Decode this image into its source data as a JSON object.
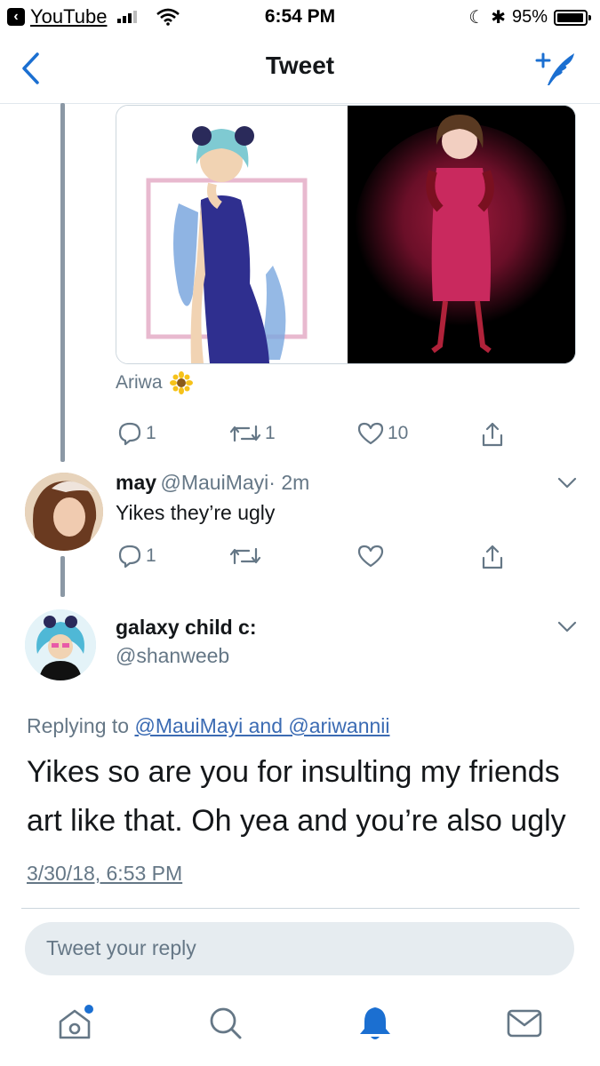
{
  "status_bar": {
    "back_app": "YouTube",
    "time": "6:54 PM",
    "battery": "95%"
  },
  "nav": {
    "title": "Tweet",
    "back_icon": "chevron-left-icon",
    "compose_icon": "compose-tweet-icon"
  },
  "quoted_tweet": {
    "author": "Ariwa",
    "author_emoji": "sunflower-icon",
    "replies": "1",
    "retweets": "1",
    "likes": "10"
  },
  "reply_tweet": {
    "name": "may",
    "handle": "@MauiMayi",
    "time": "· 2m",
    "text": "Yikes they’re ugly",
    "replies": "1"
  },
  "main_tweet": {
    "name": "galaxy child c:",
    "handle": "@shanweeb",
    "replying_prefix": "Replying to ",
    "replying_to": "@MauiMayi and @ariwannii",
    "text": "Yikes so are you for insulting my friends art like that. Oh yea and you’re also ugly",
    "timestamp": "3/30/18, 6:53 PM"
  },
  "reply_input": {
    "placeholder": "Tweet your reply"
  },
  "tab_bar": {
    "items": [
      "home-icon",
      "search-icon",
      "notifications-icon",
      "messages-icon"
    ],
    "active": "notifications-icon"
  },
  "colors": {
    "accent": "#1da1f2",
    "muted": "#657786",
    "text": "#14171a",
    "nav_blue": "#1b6fd1"
  }
}
